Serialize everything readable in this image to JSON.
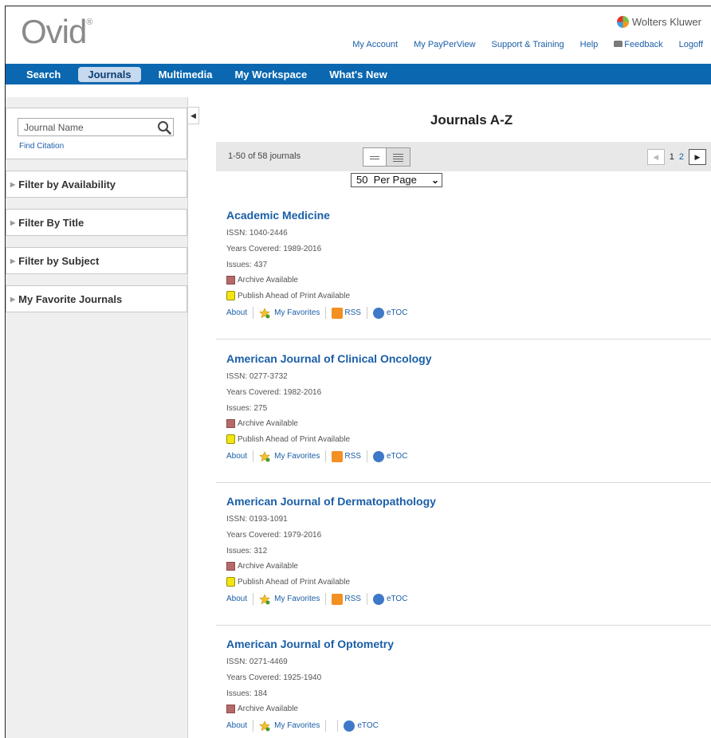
{
  "header": {
    "logo": "Ovid",
    "logo_mark": "®",
    "brand": "Wolters Kluwer",
    "links": [
      "My Account",
      "My PayPerView",
      "Support & Training",
      "Help",
      "Feedback",
      "Logoff"
    ]
  },
  "mainnav": {
    "items": [
      "Search",
      "Journals",
      "Multimedia",
      "My Workspace",
      "What's New"
    ],
    "active": "Journals"
  },
  "sidebar": {
    "search_placeholder": "Journal Name",
    "find_citation": "Find Citation",
    "filters": [
      "Filter by Availability",
      "Filter By Title",
      "Filter by Subject",
      "My Favorite Journals"
    ]
  },
  "main": {
    "title": "Journals A-Z",
    "count": "1-50 of 58 journals",
    "per_page": "50  Per Page",
    "pages": [
      "1",
      "2"
    ],
    "current_page": "1"
  },
  "journals": [
    {
      "title": "Academic Medicine",
      "issn": "ISSN: 1040-2446",
      "years": "Years Covered: 1989-2016",
      "issues": "Issues: 437",
      "archive": "Archive Available",
      "pap": "Publish Ahead of Print Available",
      "about": "About",
      "favorites": "My Favorites",
      "rss": "RSS",
      "etoc": "eTOC"
    },
    {
      "title": "American Journal of Clinical Oncology",
      "issn": "ISSN: 0277-3732",
      "years": "Years Covered: 1982-2016",
      "issues": "Issues: 275",
      "archive": "Archive Available",
      "pap": "Publish Ahead of Print Available",
      "about": "About",
      "favorites": "My Favorites",
      "rss": "RSS",
      "etoc": "eTOC"
    },
    {
      "title": "American Journal of Dermatopathology",
      "issn": "ISSN: 0193-1091",
      "years": "Years Covered: 1979-2016",
      "issues": "Issues: 312",
      "archive": "Archive Available",
      "pap": "Publish Ahead of Print Available",
      "about": "About",
      "favorites": "My Favorites",
      "rss": "RSS",
      "etoc": "eTOC"
    },
    {
      "title": "American Journal of Optometry",
      "issn": "ISSN: 0271-4469",
      "years": "Years Covered: 1925-1940",
      "issues": "Issues: 184",
      "archive": "Archive Available",
      "about": "About",
      "favorites": "My Favorites",
      "etoc": "eTOC"
    }
  ],
  "colors": {
    "nav_blue": "#0a67b0",
    "link_blue": "#1a5ea8"
  }
}
